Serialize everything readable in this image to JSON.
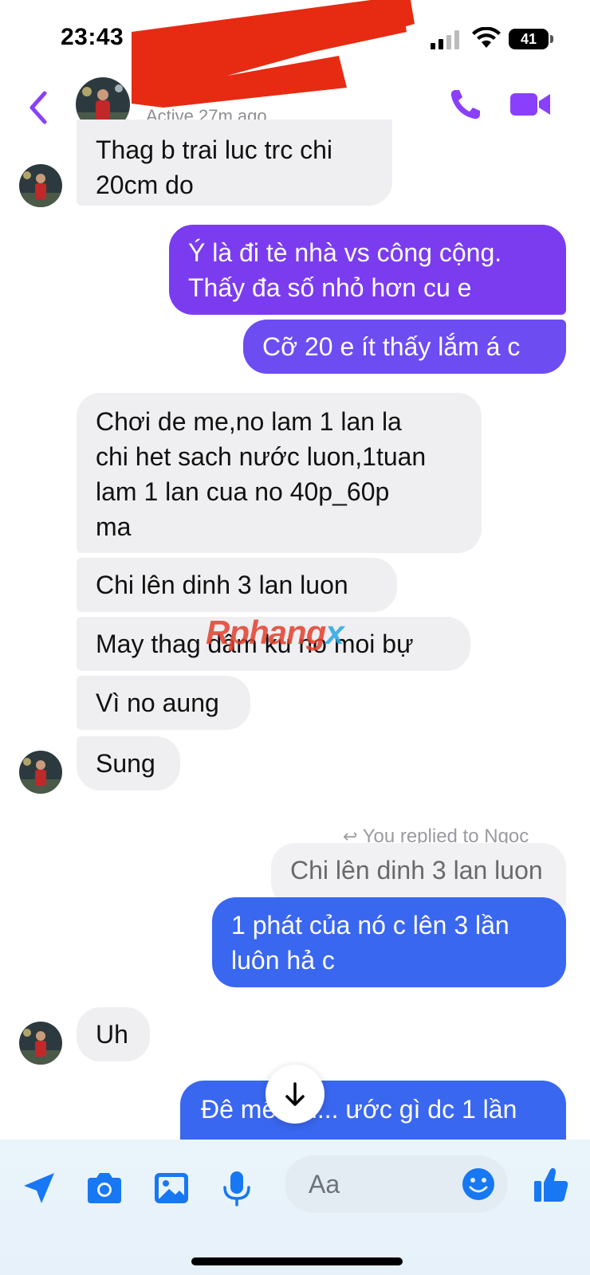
{
  "status": {
    "time": "23:43",
    "battery": "41"
  },
  "header": {
    "active_text": "Active 27m ago"
  },
  "colors": {
    "accent": "#8a3ffc",
    "outgoing_purple": "#7b3cf0",
    "outgoing_blue": "#3a67f0",
    "incoming_bg": "#efeff1",
    "redaction": "#e62b12"
  },
  "messages": [
    {
      "text_lines": [
        "Thag b trai luc trc chi",
        "20cm do"
      ]
    },
    {
      "text_lines": [
        "Ý là đi tè nhà vs công cộng.",
        "Thấy đa số nhỏ hơn cu e"
      ]
    },
    {
      "text_lines": [
        "Cỡ 20 e ít thấy lắm á c"
      ]
    },
    {
      "text_lines": [
        "Chơi de me,no lam 1 lan la",
        "chi het sach nước luon,1tuan",
        "lam 1 lan cua no 40p_60p",
        "ma"
      ]
    },
    {
      "text_lines": [
        "Chi lên dinh 3 lan luon"
      ]
    },
    {
      "text_lines": [
        "May thag dâm ku no moi bự"
      ]
    },
    {
      "text_lines": [
        "Vì no aung"
      ]
    },
    {
      "text_lines": [
        "Sung"
      ]
    },
    {
      "text_lines": [
        "Chi lên dinh 3 lan luon"
      ]
    },
    {
      "text_lines": [
        "1 phát của nó c lên 3 lần",
        "luôn hả c"
      ]
    },
    {
      "text_lines": [
        "Uh"
      ]
    },
    {
      "text_lines": [
        "Đê mê nhỉ... ước gì dc 1 lần"
      ]
    }
  ],
  "reply_label": "You replied to Ngoc",
  "watermark": "Rphangx",
  "composer": {
    "placeholder": "Aa"
  },
  "icons": {
    "back": "chevron-left-icon",
    "call": "phone-icon",
    "video": "video-camera-icon",
    "location": "location-arrow-icon",
    "camera": "camera-icon",
    "gallery": "image-icon",
    "mic": "microphone-icon",
    "emoji": "emoji-icon",
    "like": "thumbs-up-icon",
    "scroll_down": "arrow-down-icon",
    "reply": "reply-arrow-icon"
  }
}
